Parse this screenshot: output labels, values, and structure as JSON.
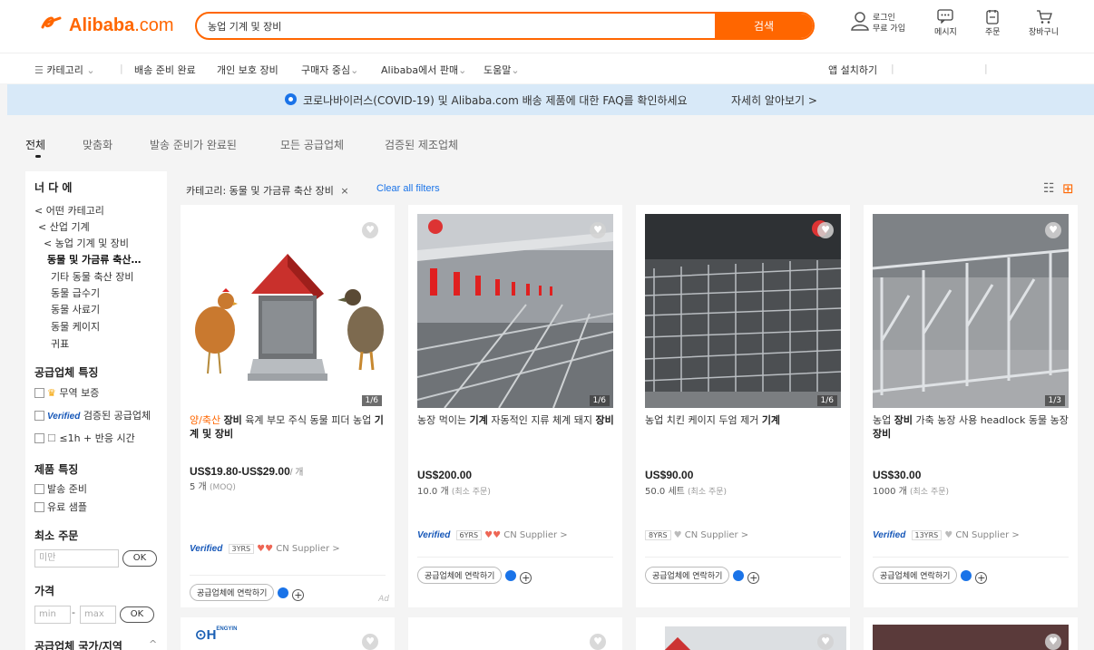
{
  "header": {
    "logo_text": "Alibaba",
    "logo_suffix": ".com",
    "search_value": "농업 기계 및 장비",
    "search_button": "검색",
    "login": "로그인",
    "signup": "무료 가입",
    "messages": "메시지",
    "orders": "주문",
    "cart": "장바구니"
  },
  "nav": {
    "categories": "카테고리",
    "ready_to_ship": "배송 준비 완료",
    "ppe": "개인 보호 장비",
    "buyer_central": "구매자 중심",
    "sell": "Alibaba에서 판매",
    "help": "도움말",
    "get_app": "앱 설치하기"
  },
  "banner": {
    "text": "코로나바이러스(COVID-19) 및 Alibaba.com 배송 제품에 대한 FAQ를 확인하세요",
    "link": "자세히 알아보기 >"
  },
  "tabs": [
    "전체",
    "맞춤화",
    "발송 준비가 완료된",
    "모든 공급업체",
    "검증된 제조업체"
  ],
  "sidebar": {
    "title": "너 다 에",
    "cat_any": "< 어떤 카테고리",
    "cat_industrial": "< 산업 기계",
    "cat_agri": "< 농업 기계 및 장비",
    "cat_current": "동물 및 가금류 축산…",
    "cat_other": "기타 동물 축산 장비",
    "cat_drinkers": "동물 급수기",
    "cat_feeders": "동물 사료기",
    "cat_cages": "동물 케이지",
    "cat_eartag": "귀표",
    "supplier_features": "공급업체 특징",
    "trade_assurance": "무역 보증",
    "verified_label": "Verified",
    "verified_supplier": "검증된 공급업체",
    "response_time": "≤1h + 반응 시간",
    "product_features": "제품 특징",
    "ready_ship": "발송 준비",
    "paid_samples": "유료 샘플",
    "min_order": "최소 주문",
    "min_placeholder": "미만",
    "ok": "OK",
    "price": "가격",
    "price_min": "min",
    "price_max": "max",
    "country": "공급업체 국가/지역"
  },
  "filter": {
    "chip": "카테고리: 동물 및 가금류 축산 장비",
    "chip_close": "×",
    "clear_all": "Clear all filters"
  },
  "products": [
    {
      "title_pre": "양/축산 ",
      "title_bold": "장비",
      "title_post": " 육계 부모 주식 동물 피더 농업 ",
      "title_bold2": "기계 및 장비",
      "counter": "1/6",
      "price": "US$19.80-US$29.00",
      "per": "/ 개",
      "moq": "5 개",
      "moq_label": "(MOQ)",
      "verified": "Verified",
      "yrs": "3YRS",
      "supplier": "CN Supplier >",
      "contact": "공급업체에 연락하기",
      "ad": "Ad"
    },
    {
      "title_pre": "농장 먹이는 ",
      "title_bold": "기계",
      "title_post": " 자동적인 지류 체계 돼지 ",
      "title_bold2": "장비",
      "counter": "1/6",
      "price": "US$200.00",
      "per": "",
      "moq": "10.0 개",
      "moq_label": "(최소 주문)",
      "verified": "Verified",
      "yrs": "6YRS",
      "supplier": "CN Supplier >",
      "contact": "공급업체에 연락하기"
    },
    {
      "title_pre": "농업 치킨 케이지 두엄 제거 ",
      "title_bold": "기계",
      "title_post": "",
      "title_bold2": "",
      "counter": "1/6",
      "price": "US$90.00",
      "per": "",
      "moq": "50.0 세트",
      "moq_label": "(최소 주문)",
      "verified": "",
      "yrs": "8YRS",
      "supplier": "CN Supplier >",
      "contact": "공급업체에 연락하기"
    },
    {
      "title_pre": "농업 ",
      "title_bold": "장비",
      "title_post": " 가축 농장 사용 headlock 동물 농장 ",
      "title_bold2": "장비",
      "counter": "1/3",
      "price": "US$30.00",
      "per": "",
      "moq": "1000 개",
      "moq_label": "(최소 주문)",
      "verified": "Verified",
      "yrs": "13YRS",
      "supplier": "CN Supplier >",
      "contact": "공급업체에 연락하기"
    }
  ],
  "second_row_logo": "ENGYIN",
  "colors": {
    "brand": "#ff6600",
    "banner_bg": "#d8e9f8",
    "link": "#1a73e8",
    "verified": "#1657b8"
  },
  "icons": [
    "alibaba-logo-icon",
    "user-icon",
    "message-icon",
    "order-icon",
    "cart-icon",
    "menu-icon",
    "location-pin-icon",
    "heart-icon",
    "chat-icon",
    "plus-icon",
    "list-view-icon",
    "grid-view-icon"
  ]
}
